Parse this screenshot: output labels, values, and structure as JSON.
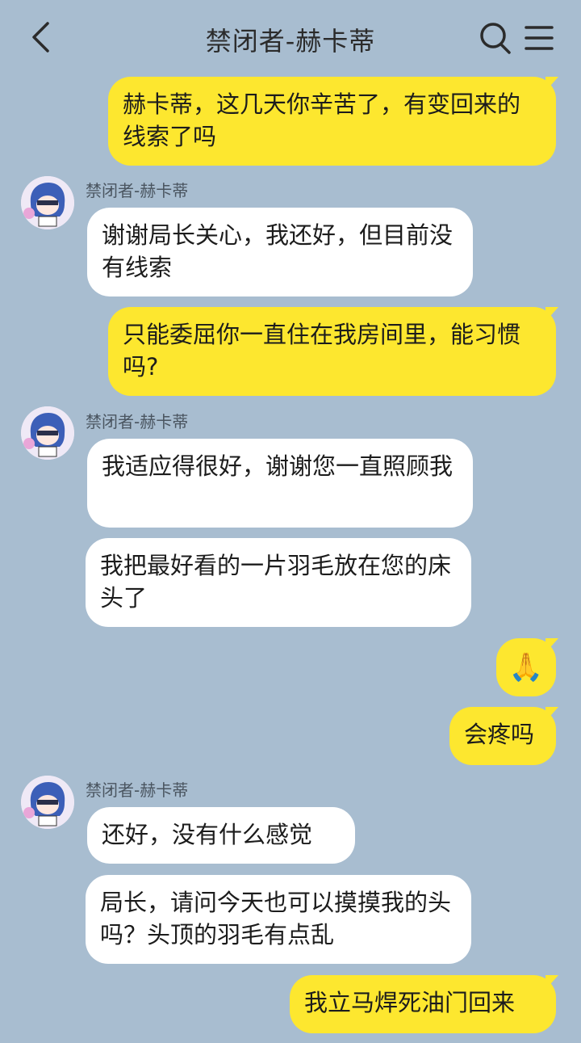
{
  "header": {
    "title": "禁闭者-赫卡蒂",
    "back_icon": "chevron-left-icon",
    "search_icon": "search-icon",
    "menu_icon": "menu-icon"
  },
  "colors": {
    "background": "#a8bdd0",
    "my_bubble": "#fde72f",
    "their_bubble": "#ffffff"
  },
  "messages": [
    {
      "from": "me",
      "text": "赫卡蒂，这几天你辛苦了，有变回来的线索了吗"
    },
    {
      "from": "other",
      "sender": "禁闭者-赫卡蒂",
      "text": "谢谢局长关心，我还好，但目前没有线索"
    },
    {
      "from": "me",
      "text": "只能委屈你一直住在我房间里，能习惯吗?"
    },
    {
      "from": "other",
      "sender": "禁闭者-赫卡蒂",
      "text": "我适应得很好，谢谢您一直照顾我"
    },
    {
      "from": "other",
      "text": "我把最好看的一片羽毛放在您的床头了"
    },
    {
      "from": "me",
      "emoji": "🙏",
      "emoji_name": "pleading-face-emoji"
    },
    {
      "from": "me",
      "text": "会疼吗"
    },
    {
      "from": "other",
      "sender": "禁闭者-赫卡蒂",
      "text": "还好，没有什么感觉"
    },
    {
      "from": "other",
      "text": "局长，请问今天也可以摸摸我的头吗？头顶的羽毛有点乱"
    },
    {
      "from": "me",
      "text": "我立马焊死油门回来"
    }
  ]
}
